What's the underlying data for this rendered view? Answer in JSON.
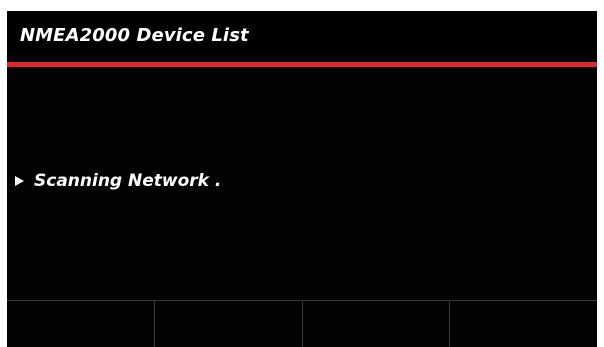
{
  "header": {
    "title": "NMEA2000 Device List"
  },
  "status": {
    "icon": "play-arrow-icon",
    "text": "Scanning Network ."
  },
  "softkeys": [
    {
      "label": ""
    },
    {
      "label": ""
    },
    {
      "label": ""
    },
    {
      "label": ""
    }
  ],
  "colors": {
    "background": "#030303",
    "accent": "#e0262b",
    "text": "#ffffff",
    "divider": "#3a3a3a"
  }
}
